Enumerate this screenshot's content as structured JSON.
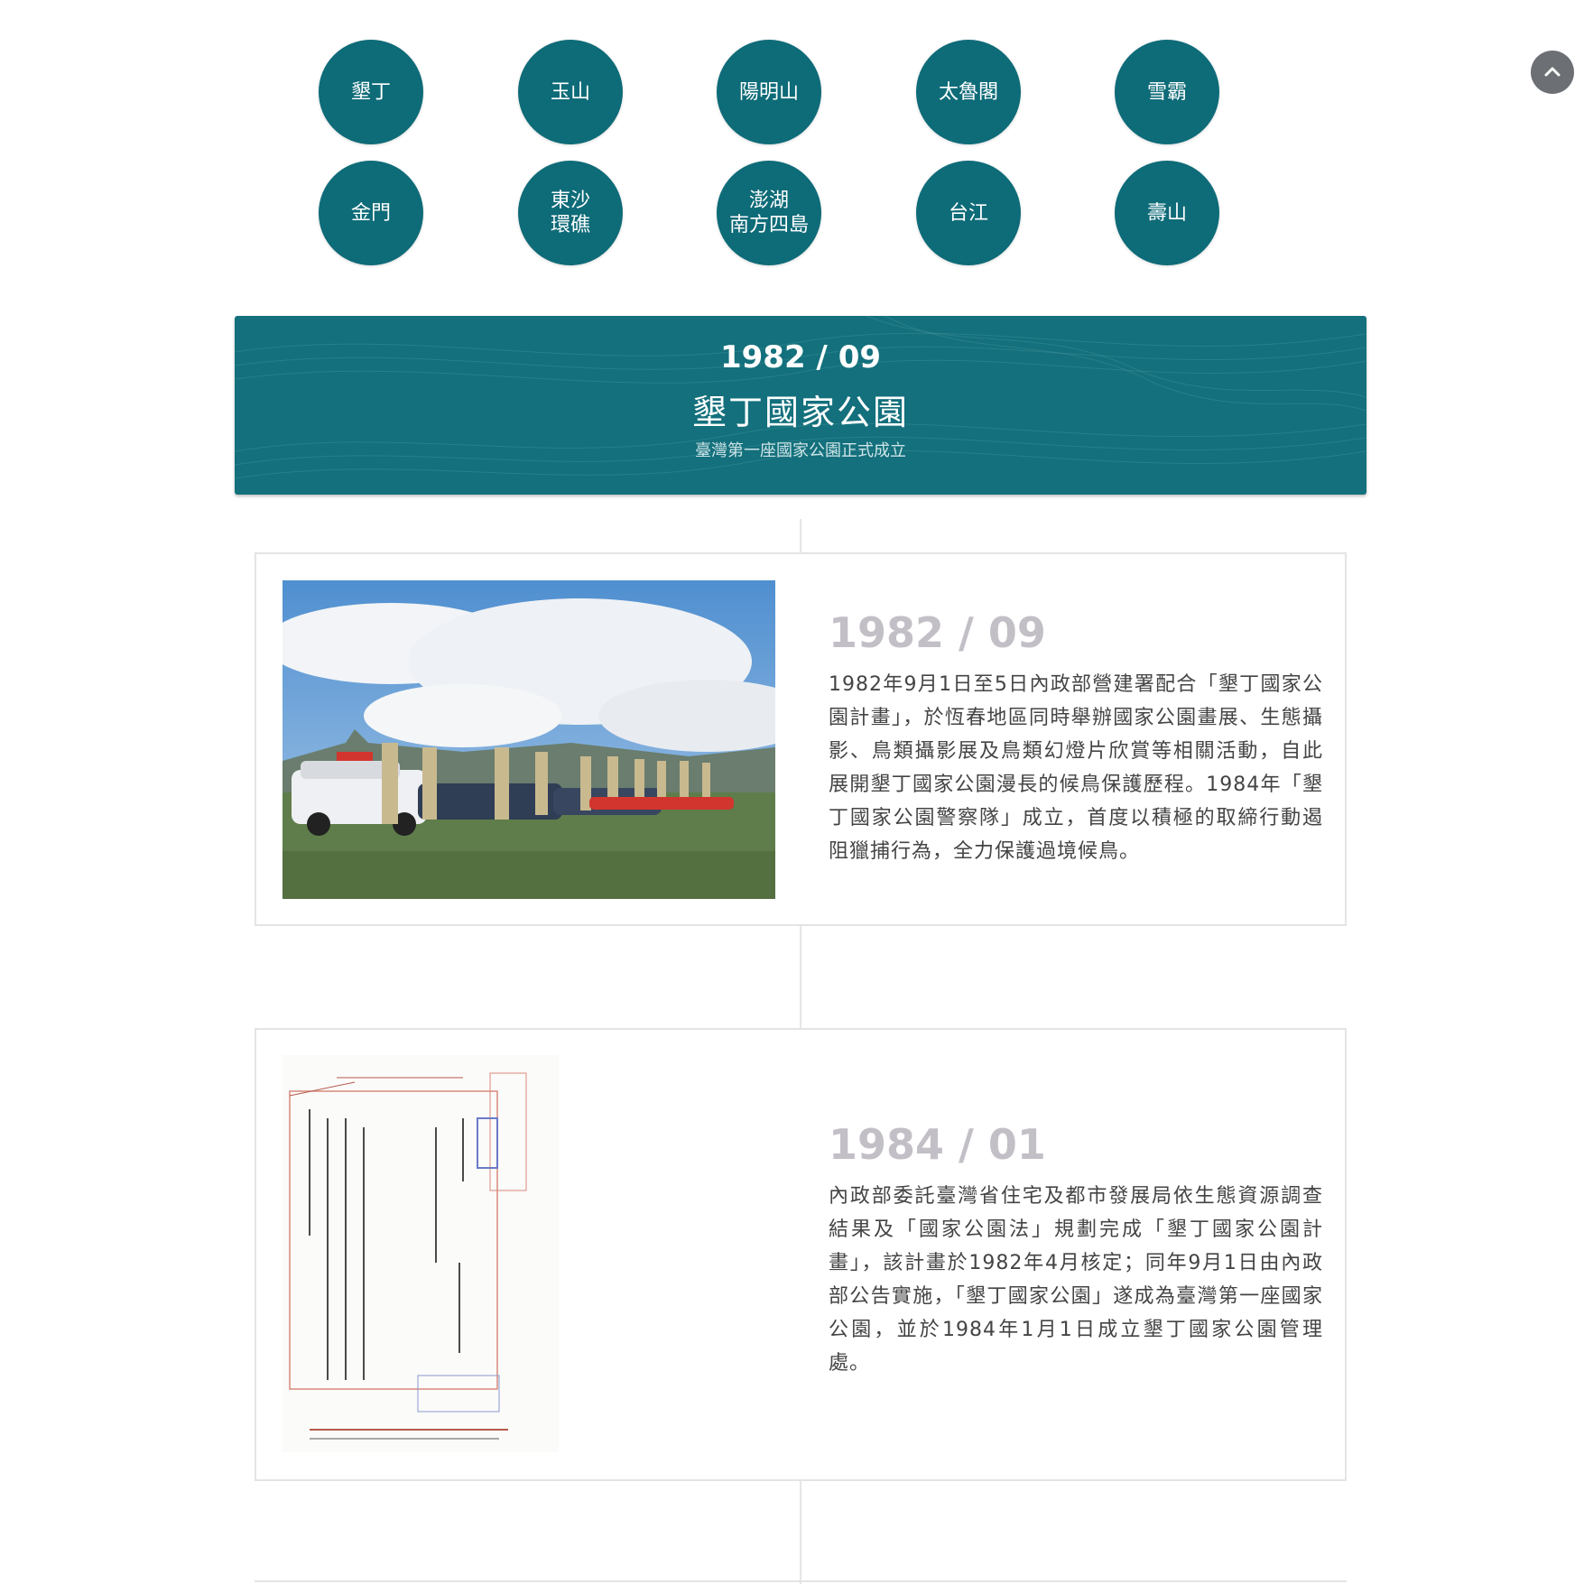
{
  "park_nav": {
    "row1": [
      {
        "lines": [
          "墾丁"
        ]
      },
      {
        "lines": [
          "玉山"
        ]
      },
      {
        "lines": [
          "陽明山"
        ]
      },
      {
        "lines": [
          "太魯閣"
        ]
      },
      {
        "lines": [
          "雪霸"
        ]
      }
    ],
    "row2": [
      {
        "lines": [
          "金門"
        ]
      },
      {
        "lines": [
          "東沙",
          "環礁"
        ]
      },
      {
        "lines": [
          "澎湖",
          "南方四島"
        ]
      },
      {
        "lines": [
          "台江"
        ]
      },
      {
        "lines": [
          "壽山"
        ]
      }
    ]
  },
  "back_to_top": {
    "icon": "chevron-up-icon"
  },
  "banner": {
    "date": "1982 / 09",
    "title": "墾丁國家公園",
    "subtitle": "臺灣第一座國家公園正式成立",
    "bg_color": "#13707c"
  },
  "entries": [
    {
      "date": "1982 / 09",
      "text": "1982年9月1日至5日內政部營建署配合「墾丁國家公園計畫」，於恆春地區同時舉辦國家公園畫展、生態攝影、鳥類攝影展及鳥類幻燈片欣賞等相關活動，自此展開墾丁國家公園漫長的候鳥保護歷程。1984年「墾丁國家公園警察隊」成立，首度以積極的取締行動遏阻獵捕行為，全力保護過境候鳥。",
      "image": "police-lineup-photo"
    },
    {
      "date": "1984 / 01",
      "text": "內政部委託臺灣省住宅及都市發展局依生態資源調查結果及「國家公園法」規劃完成「墾丁國家公園計畫」，該計畫於1982年4月核定；同年9月1日由內政部公告實施，「墾丁國家公園」遂成為臺灣第一座國家公園，並於1984年1月1日成立墾丁國家公園管理處。",
      "image": "official-document-scan"
    }
  ],
  "colors": {
    "accent": "#0e6b78",
    "date_gray": "#c3bfc6"
  }
}
